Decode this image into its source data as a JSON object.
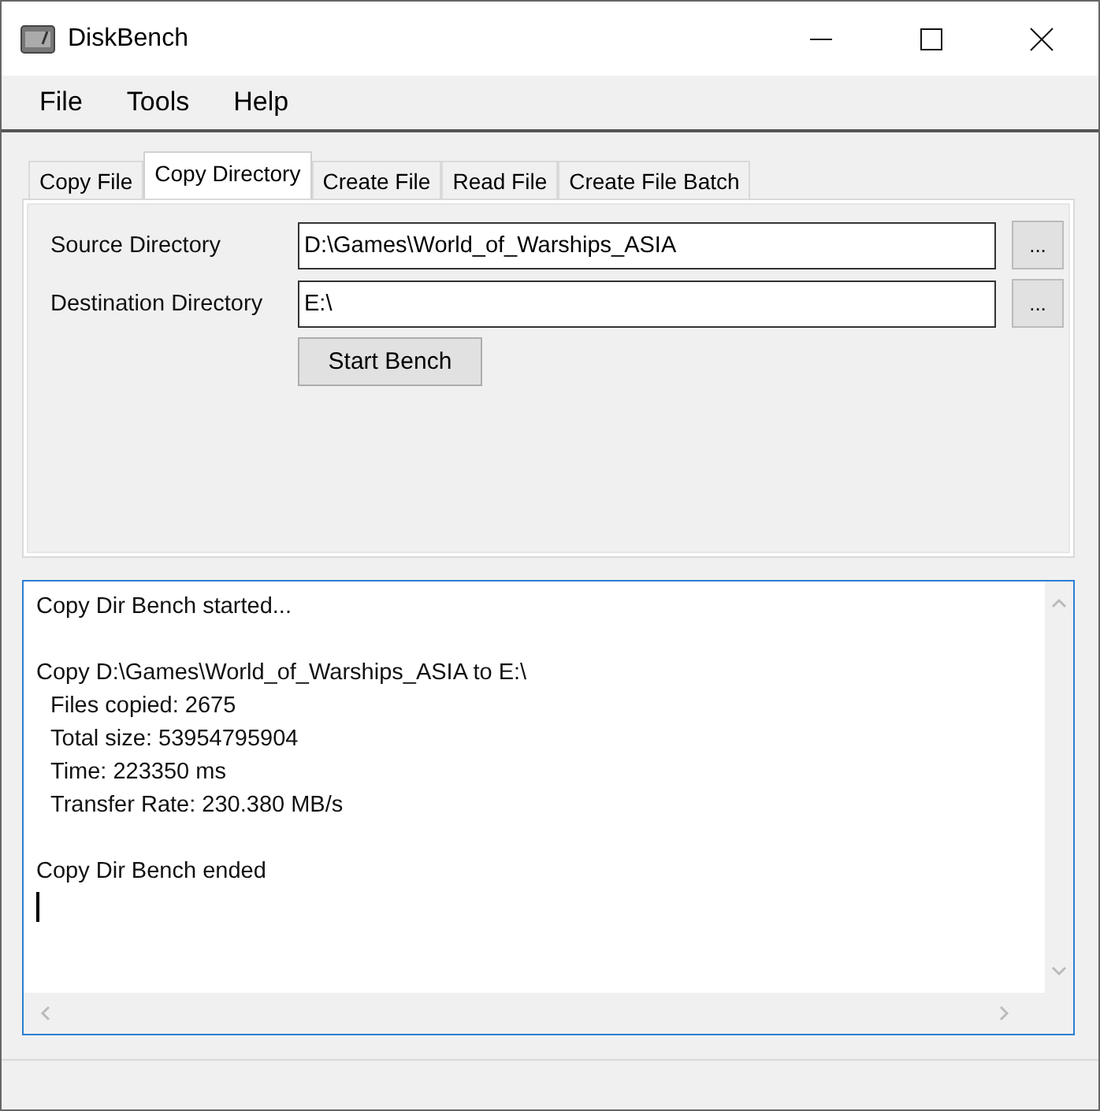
{
  "window": {
    "title": "DiskBench"
  },
  "menu": [
    "File",
    "Tools",
    "Help"
  ],
  "tabs": [
    {
      "label": "Copy File",
      "selected": false
    },
    {
      "label": "Copy Directory",
      "selected": true
    },
    {
      "label": "Create File",
      "selected": false
    },
    {
      "label": "Read File",
      "selected": false
    },
    {
      "label": "Create File Batch",
      "selected": false
    }
  ],
  "fields": [
    {
      "label": "Source Directory",
      "value": "D:\\Games\\World_of_Warships_ASIA",
      "browse": "..."
    },
    {
      "label": "Destination Directory",
      "value": "E:\\",
      "browse": "..."
    }
  ],
  "start_button": "Start Bench",
  "log": {
    "paragraphs": [
      {
        "message": "Copy Dir Bench started..."
      },
      {
        "message": "Copy D:\\Games\\World_of_Warships_ASIA to E:\\",
        "details": [
          "Files copied: 2675",
          "Total size: 53954795904",
          "Time: 223350 ms",
          "Transfer Rate: 230.380 MB/s"
        ]
      },
      {
        "message": "Copy Dir Bench ended"
      }
    ],
    "caret": true
  }
}
